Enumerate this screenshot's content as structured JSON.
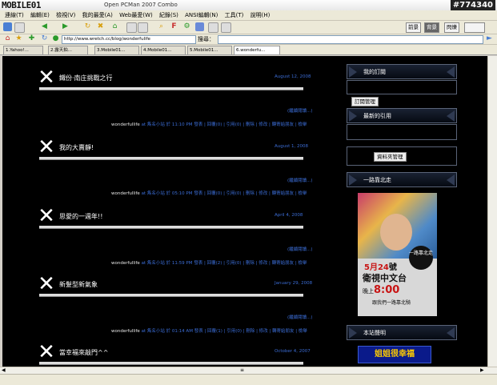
{
  "window": {
    "logo": "MOBILE01",
    "title": "Open PCMan 2007 Combo",
    "watermark": "#774340"
  },
  "menu": {
    "items": [
      "連線(T)",
      "編輯(E)",
      "檢視(V)",
      "我的最愛(A)",
      "Web最愛(W)",
      "紀錄(S)",
      "ANSI編輯(N)",
      "工具(T)",
      "說明(H)"
    ]
  },
  "toolbar": {
    "btn1": "前景",
    "btn2": "背景",
    "btn3": "閃爍"
  },
  "address": {
    "url": "http://www.wretch.cc/blog/wonderfulife",
    "search_label": "搜尋："
  },
  "tabs": [
    {
      "label": "1.Yahoo!..."
    },
    {
      "label": "2.露天拍..."
    },
    {
      "label": "3.Mobile01..."
    },
    {
      "label": "4.Mobile01..."
    },
    {
      "label": "5.Mobile01..."
    },
    {
      "label": "6.wonderfu..."
    }
  ],
  "posts": [
    {
      "title": "鐵份·南庄挑戰之行",
      "date": "August 12, 2008",
      "readmore": "(繼續閱讀...)",
      "author": "wonderfullife",
      "meta": "at 雋名小站 於 11:10 PM 發表",
      "links": "| 回覆(0) | 引用(0) | 刪除 | 修改 | 轉寄給朋友 | 檢舉"
    },
    {
      "title": "我的大賣靜!",
      "date": "August 1, 2008",
      "readmore": "(繼續閱讀...)",
      "author": "wonderfullife",
      "meta": "at 雋名小站 於 05:10 PM 發表",
      "links": "| 回覆(0) | 引用(0) | 刪除 | 修改 | 轉寄給朋友 | 檢舉"
    },
    {
      "title": "思愛的一週年!!",
      "date": "April 4, 2008",
      "readmore": "(繼續閱讀...)",
      "author": "wonderfullife",
      "meta": "at 雋名小站 於 11:59 PM 發表",
      "links": "| 回覆(2) | 引用(0) | 刪除 | 修改 | 轉寄給朋友 | 檢舉"
    },
    {
      "title": "新髮型新氣象",
      "date": "January 29, 2008",
      "readmore": "(繼續閱讀...)",
      "author": "wonderfullife",
      "meta": "at 雋名小站 於 01:14 AM 發表",
      "links": "| 回覆(1) | 引用(0) | 刪除 | 修改 | 轉寄給朋友 | 檢舉"
    },
    {
      "title": "當幸福來敲門^^",
      "date": "October 4, 2007"
    }
  ],
  "sidebar": {
    "subscribe_title": "我的訂閱",
    "subscribe_button": "訂閱管理",
    "trackback_title": "最新的引用",
    "manage_button": "資料夾管理",
    "ad_section_title": "一路靠北走",
    "ad": {
      "badge": "一路靠北走",
      "line1_date": "5月24",
      "line1_suffix": "號",
      "line2": "衛視中文台",
      "line3_prefix": "晚上",
      "line3_time": "8:00",
      "line4": "跟我們一路靠北騎"
    },
    "statement_title": "本站聲明",
    "banner": "姐姐很幸福"
  },
  "colors": {
    "background": "#000000",
    "link": "#3b6cd4",
    "title_text": "#ffffff"
  }
}
